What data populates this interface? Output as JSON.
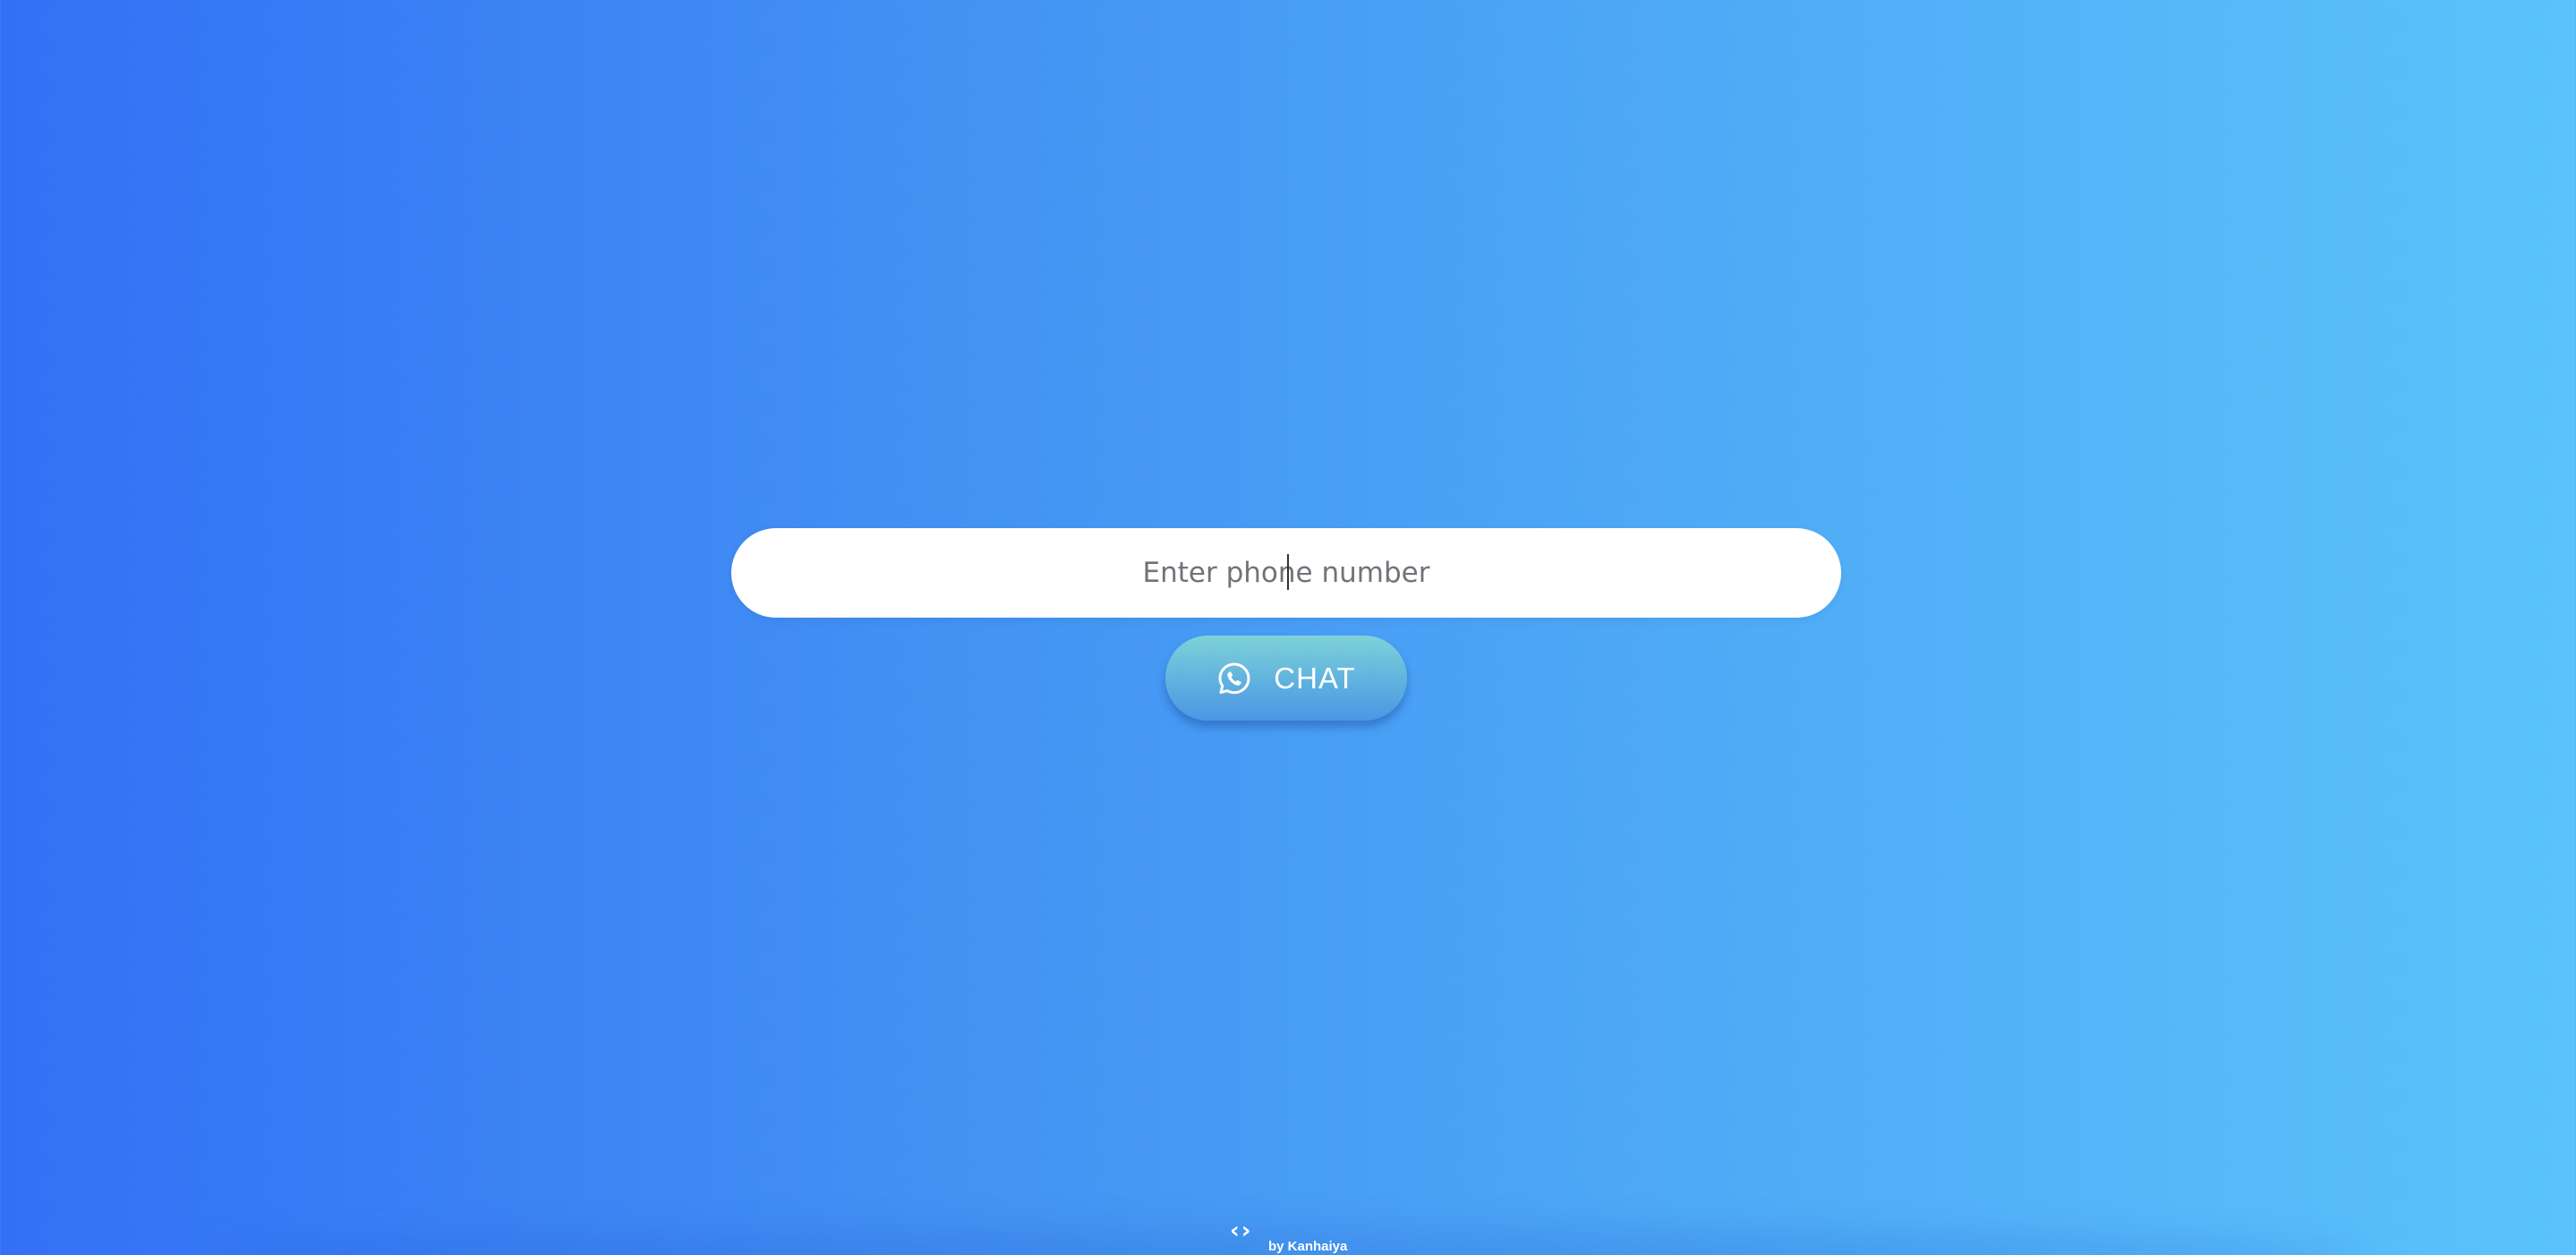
{
  "form": {
    "phone_input": {
      "placeholder": "Enter phone number",
      "value": ""
    },
    "chat_button": {
      "label": "CHAT",
      "icon": "whatsapp-icon"
    }
  },
  "footer": {
    "icon": "code-icon",
    "icon_glyph": "‹›",
    "credit": "by Kanhaiya"
  },
  "colors": {
    "background_start": "#3370f6",
    "background_end": "#5bc3fb",
    "input_background": "#ffffff",
    "button_gradient_top": "#7fd2d8",
    "button_gradient_bottom": "#4e96e4",
    "button_text": "#ffffff"
  }
}
